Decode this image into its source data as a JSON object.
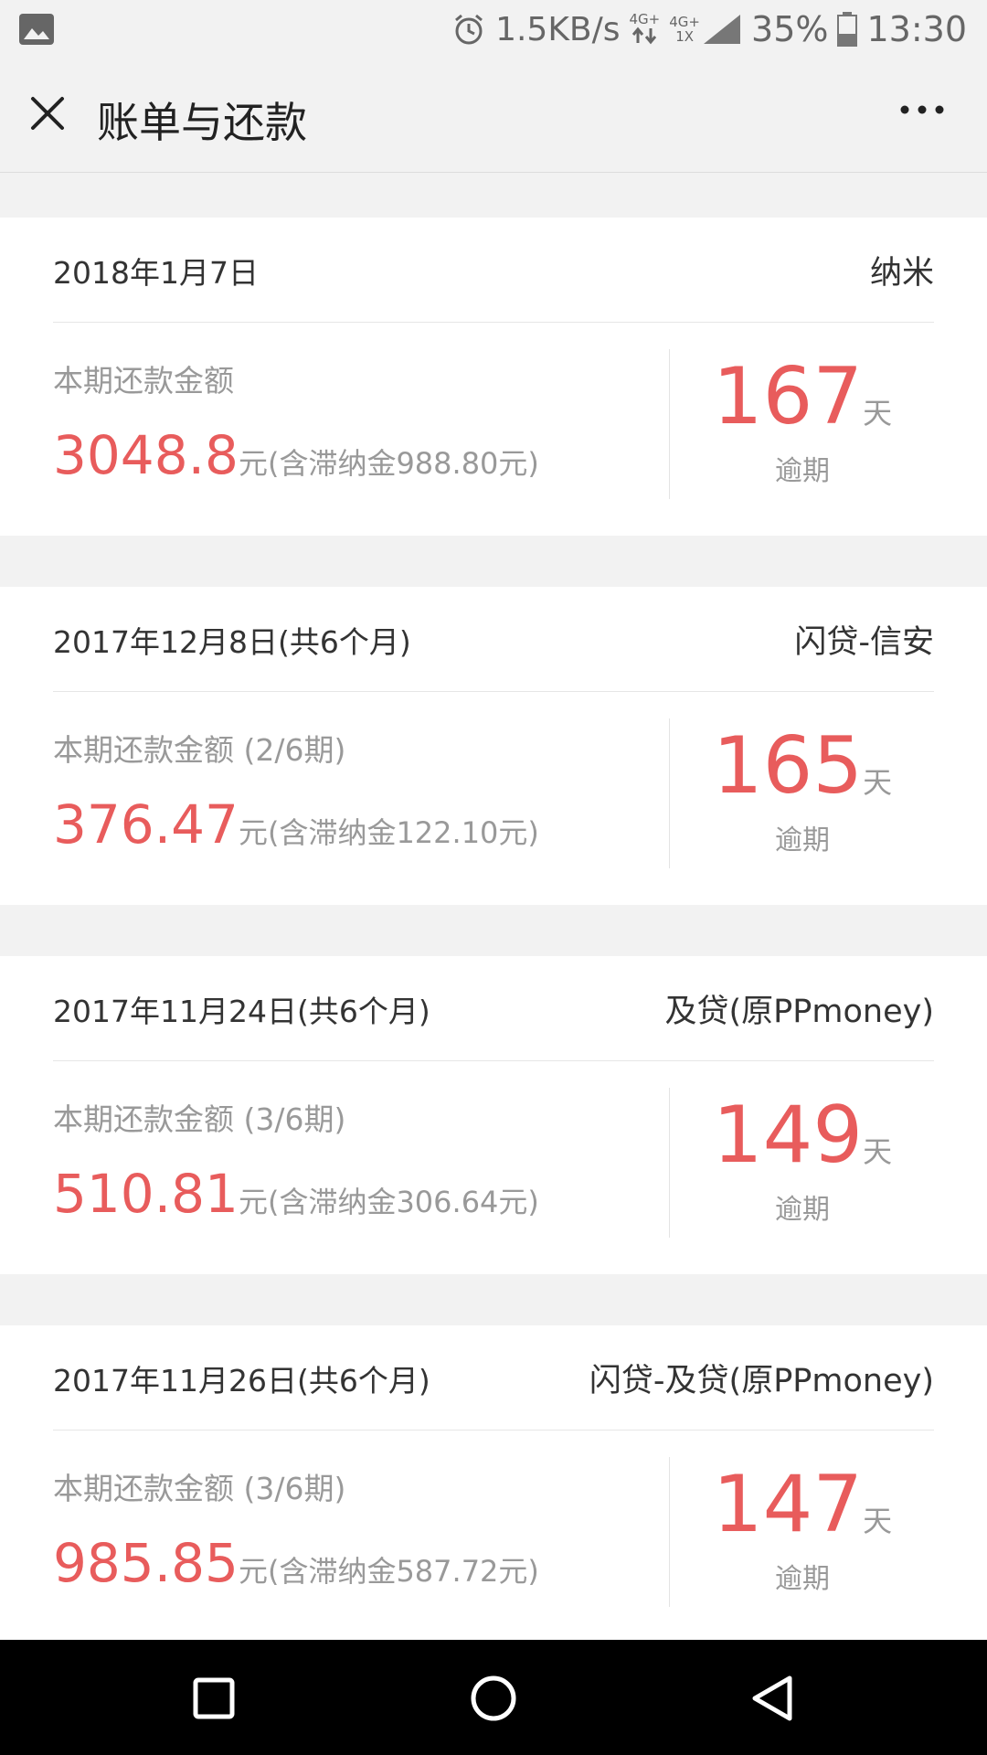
{
  "status_bar": {
    "net_speed": "1.5KB/s",
    "sig1_top": "4G+",
    "sig2_top": "4G+",
    "sig2_bottom": "1X",
    "battery": "35%",
    "time": "13:30"
  },
  "title_bar": {
    "title": "账单与还款",
    "close_icon": "close-icon",
    "more_icon": "more-icon"
  },
  "bills": [
    {
      "date": "2018年1月7日",
      "lender": "纳米",
      "label": "本期还款金额",
      "amount": "3048.8",
      "amount_suffix": "元(含滞纳金988.80元)",
      "days": "167",
      "days_unit": "天",
      "status": "逾期"
    },
    {
      "date": "2017年12月8日(共6个月)",
      "lender": "闪贷-信安",
      "label": "本期还款金额 (2/6期)",
      "amount": "376.47",
      "amount_suffix": "元(含滞纳金122.10元)",
      "days": "165",
      "days_unit": "天",
      "status": "逾期"
    },
    {
      "date": "2017年11月24日(共6个月)",
      "lender": "及贷(原PPmoney)",
      "label": "本期还款金额 (3/6期)",
      "amount": "510.81",
      "amount_suffix": "元(含滞纳金306.64元)",
      "days": "149",
      "days_unit": "天",
      "status": "逾期"
    },
    {
      "date": "2017年11月26日(共6个月)",
      "lender": "闪贷-及贷(原PPmoney)",
      "label": "本期还款金额 (3/6期)",
      "amount": "985.85",
      "amount_suffix": "元(含滞纳金587.72元)",
      "days": "147",
      "days_unit": "天",
      "status": "逾期"
    }
  ],
  "colors": {
    "accent_red": "#e85c5c",
    "muted_text": "#999999",
    "background": "#f2f2f2"
  },
  "nav_bar": {
    "icons": [
      "recent-apps-icon",
      "home-icon",
      "back-icon"
    ]
  }
}
